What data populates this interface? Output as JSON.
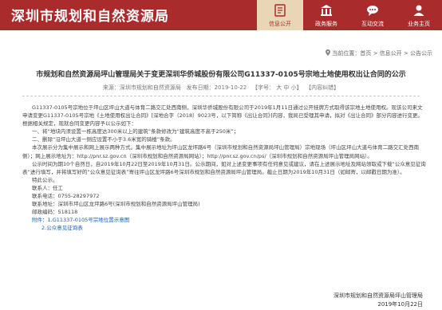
{
  "site_title": "深圳市规划和自然资源局",
  "nav": [
    {
      "label": "信息公开",
      "icon": "document-icon",
      "active": true
    },
    {
      "label": "政务服务",
      "icon": "building-icon",
      "active": false
    },
    {
      "label": "互动交流",
      "icon": "chat-icon",
      "active": false
    },
    {
      "label": "业务主页",
      "icon": "person-icon",
      "active": false
    }
  ],
  "breadcrumb": {
    "prefix": "当前位置：",
    "items": [
      "首页",
      "信息公开",
      "公告公示"
    ],
    "sep": " > "
  },
  "article": {
    "title": "市规划和自然资源局坪山管理局关于变更深圳华侨城股份有限公司G11337-0105号宗地土地使用权出让合同的公示",
    "source_label": "来源：",
    "source": "深圳市规划和自然资源局",
    "date_label": "发布日期：",
    "date": "2019-10-22",
    "font_label": "【字号：",
    "font_big": "大",
    "font_mid": "中",
    "font_small": "小",
    "font_end": "】",
    "print": "【内容纠错】",
    "paragraphs": [
      "G11337-0105号宗地位于坪山区坪山大道与体育二路交汇处西南侧，深圳华侨城股份有限公司于2019年1月11日通过公开挂牌方式取得该宗地土地使用权。现该公司来文申请变更G11337-0105号宗地《土地使用权出让合同》[深地合字（2018）9023号，以下简称《出让合同》]内容，我局已受理其申请，拟对《出让合同》部分内容进行变更。根据相关规定，现就合同变更内容予以公示如下：",
      "一、将“地块内须设置一栋高度达300米以上的建筑”条款修改为“建筑高度不高于250米”；",
      "二、删除“沿坪山大道一侧应设置不小于3.6米宽的骑楼”条款。",
      "本次展示分为集中展示和网上展示两种方式。集中展示地址为坪山区龙坪路6号（深圳市规划和自然资源局坪山管理局）宗地现场（坪山区坪山大道与体育二路交汇处西南侧）；网上展示地址为：http://pnr.sz.gov.cn（深圳市规划和自然资源局网站）；http://pnr.sz.gov.cn/ps/（深圳市规划和自然资源局坪山管理局网站）。",
      "公示时间为期10个自然日，自2019年10月22日至2019年10月31日。公示期间，如对上述变更事项有任何意见或建议，请在上述展示地址及网站领取或下载“公众意见征询表”进行填写，并将填写好的“公众意见征询表”寄往坪山区龙坪路6号深圳市规划和自然资源局坪山管理局。截止日期为2019年10月31日（如邮寄，以邮戳日期为准）。",
      "特此公示。",
      "联系人：任工",
      "联系电话：0755-28297972",
      "联系地址：深圳市坪山区龙坪路6号(深圳市规划和自然资源局坪山管理局)",
      "邮政编码：518118",
      "附件：1.G11337-0105号宗地位置示意图",
      "2.公众意见征询表"
    ],
    "signature_org": "深圳市规划和自然资源局坪山管理局",
    "signature_date": "2019年10月22日"
  }
}
